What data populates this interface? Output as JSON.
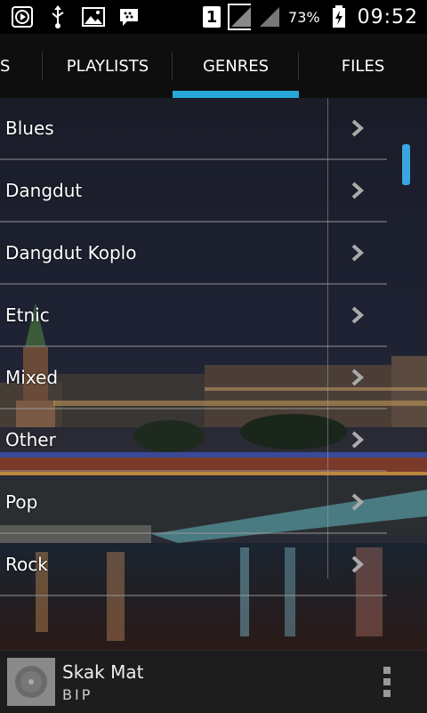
{
  "status_bar": {
    "icons_left": [
      "play-icon",
      "usb-icon",
      "image-icon",
      "bbm-icon"
    ],
    "sim": "1",
    "battery": "73%",
    "time": "09:52"
  },
  "tabs": [
    {
      "label": "S",
      "active": false
    },
    {
      "label": "PLAYLISTS",
      "active": false
    },
    {
      "label": "GENRES",
      "active": true
    },
    {
      "label": "FILES",
      "active": false
    }
  ],
  "genres": [
    {
      "label": "Blues"
    },
    {
      "label": "Dangdut"
    },
    {
      "label": "Dangdut Koplo"
    },
    {
      "label": "Etnic"
    },
    {
      "label": "Mixed"
    },
    {
      "label": "Other"
    },
    {
      "label": "Pop"
    },
    {
      "label": "Rock"
    }
  ],
  "player": {
    "title": "Skak Mat",
    "artist": "BIP"
  },
  "colors": {
    "accent": "#26a7d9",
    "tab_bar": "#0e0e0e",
    "player_bg": "#1d1d1d"
  }
}
